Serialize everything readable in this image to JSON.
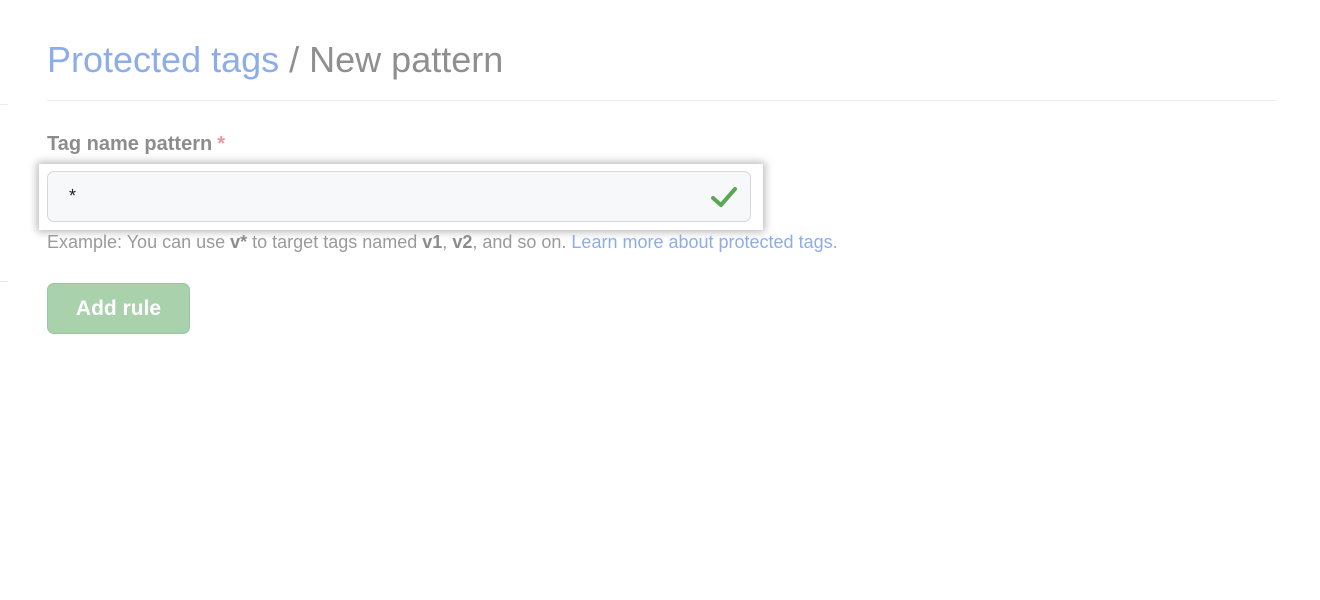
{
  "header": {
    "breadcrumb_link": "Protected tags",
    "separator": " / ",
    "current_page": "New pattern"
  },
  "form": {
    "label": "Tag name pattern",
    "required_marker": "*",
    "input_value": "*",
    "help": {
      "prefix": "Example: You can use ",
      "code_example": "v*",
      "middle": " to target tags named ",
      "example_1": "v1",
      "comma": ", ",
      "example_2": "v2",
      "suffix": ", and so on. ",
      "link_text": "Learn more about protected tags."
    },
    "submit_label": "Add rule"
  },
  "icons": {
    "valid": "check-icon"
  },
  "colors": {
    "link": "#8cade8",
    "required": "#e59b99",
    "success": "#5aa854",
    "button_bg": "#a8d1ac"
  }
}
